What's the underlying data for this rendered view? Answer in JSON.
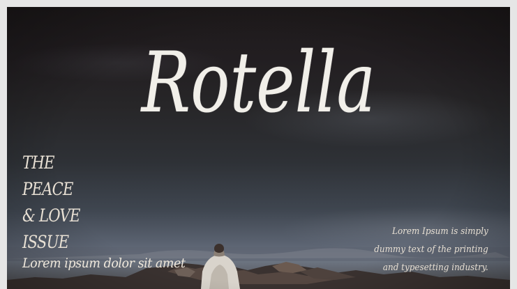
{
  "poster": {
    "title": "Rotella",
    "left_lines": [
      "THE",
      "PEACE",
      "& LOVE",
      "ISSUE"
    ],
    "tagline": "Lorem ipsum dolor sit amet",
    "right_lines": [
      "Lorem Ipsum is simply",
      "dummy text of the printing",
      "and typesetting industry."
    ]
  },
  "colors": {
    "frame": "#e6e6e6",
    "sky_top": "#1e1a1b",
    "sky_horizon": "#6d7582",
    "text": "#f3eee6"
  }
}
